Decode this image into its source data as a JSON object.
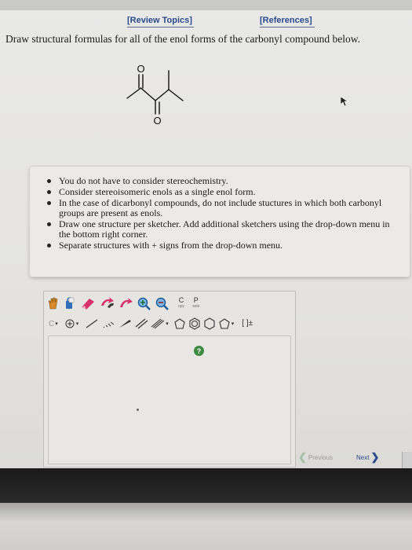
{
  "header": {
    "review_topics": "[Review Topics]",
    "references": "[References]"
  },
  "prompt": "Draw structural formulas for all of the enol forms of the carbonyl compound below.",
  "molecule": {
    "atom_top": "O",
    "atom_bottom": "O"
  },
  "hints": [
    "You do not have to consider stereochemistry.",
    "Consider stereoisomeric enols as a single enol form.",
    "In the case of dicarbonyl compounds, do not include stuctures in which both carbonyl groups are present as enols.",
    "Draw one structure per sketcher. Add additional sketchers using the drop-down menu in the bottom right corner.",
    "Separate structures with + signs from the drop-down menu."
  ],
  "toolbar": {
    "copy_letter": "C",
    "copy_small": "opy",
    "paste_letter": "P",
    "paste_small": "aste",
    "element_select": "C",
    "bracket_charge": "[ ]±"
  },
  "help_icon": "?",
  "nav": {
    "previous": "Previous",
    "next": "Next"
  },
  "colors": {
    "link": "#2a4a8a",
    "help_green": "#3f8a43"
  }
}
